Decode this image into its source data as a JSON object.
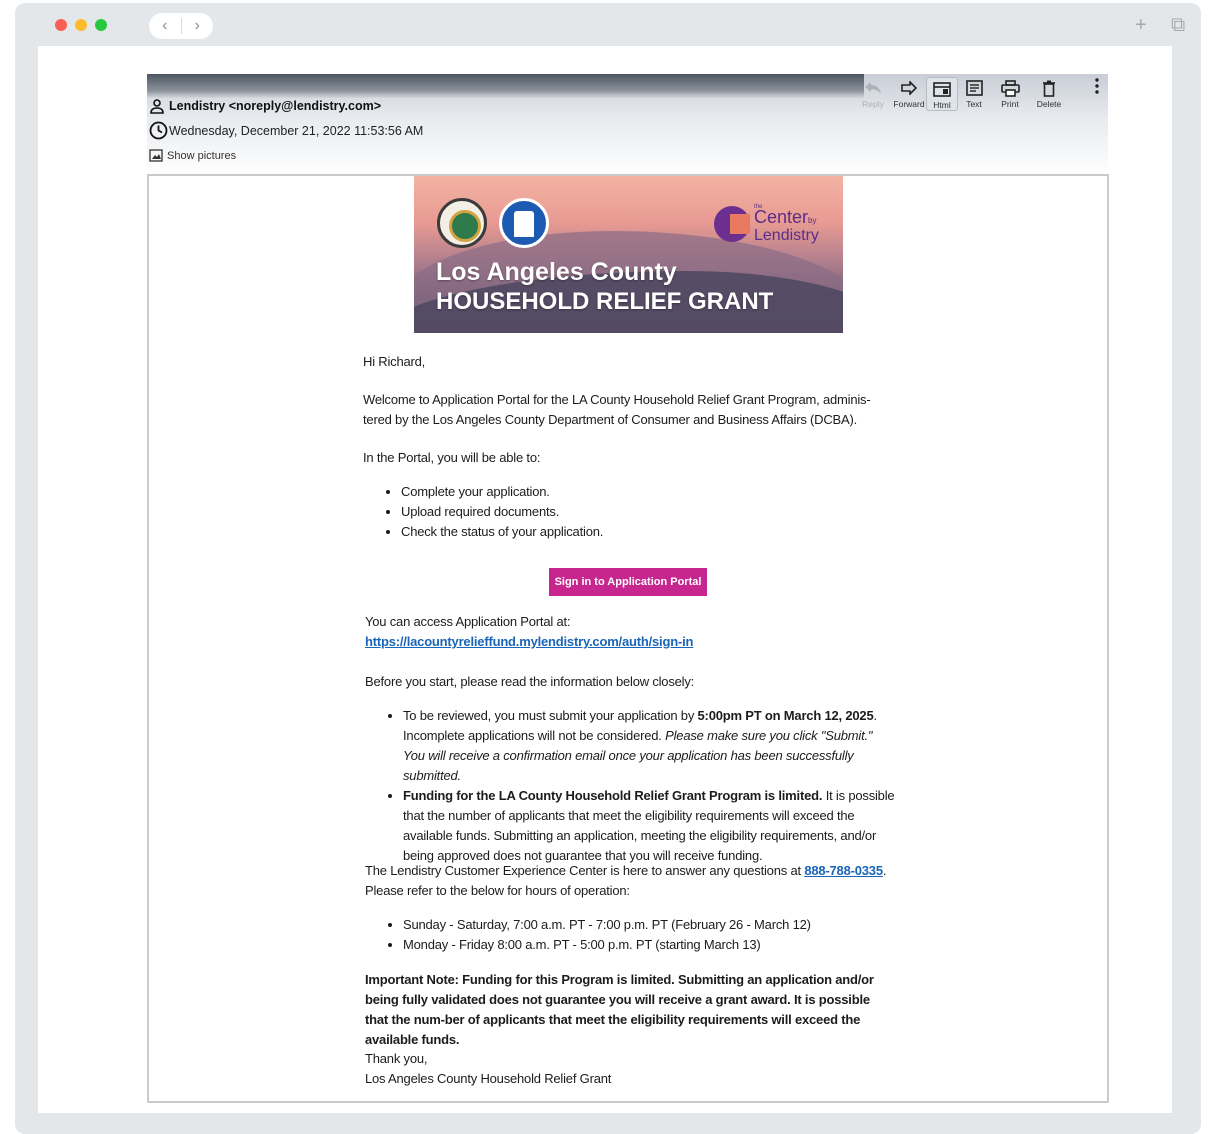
{
  "browser": {
    "nav_back": "‹",
    "nav_forward": "›",
    "new_tab": "+",
    "tabs_glyph": "⧉"
  },
  "email": {
    "from": "Lendistry <noreply@lendistry.com>",
    "date": "Wednesday, December 21, 2022 11:53:56 AM",
    "show_pictures": "Show pictures",
    "toolbar": {
      "reply": "Reply",
      "forward": "Forward",
      "html": "Html",
      "text": "Text",
      "print": "Print",
      "delete": "Delete"
    }
  },
  "hero": {
    "title_line1": "Los Angeles County",
    "title_line2": "HOUSEHOLD RELIEF GRANT",
    "brand_small": "the",
    "brand_center": "Center",
    "brand_by": "by",
    "brand_lendistry": "Lendistry"
  },
  "message": {
    "greeting": "Hi Richard,",
    "welcome": "Welcome to Application Portal for the LA County Household Relief Grant Program, adminis-tered by the Los Angeles County Department of Consumer and Business Affairs (DCBA).",
    "portal_intro": "In the Portal, you will be able to:",
    "portal_items": [
      "Complete your application.",
      "Upload required documents.",
      "Check the status of your application."
    ],
    "cta_label": "Sign in to Application Portal",
    "access_text": "You can access Application Portal at:",
    "access_url": "https://lacountyrelieffund.mylendistry.com/auth/sign-in",
    "before_start": "Before you start, please read the information below closely:",
    "info1_a": "To be reviewed, you must submit your application by ",
    "info1_b": "5:00pm PT on March 12, 2025",
    "info1_c": ". Incomplete applications will not be considered. ",
    "info1_d": "Please make sure you click \"Submit.\" You will receive a confirmation email once your application has been successfully submitted.",
    "info2_a": "Funding for the LA County Household Relief Grant Program is limited.",
    "info2_b": " It is possible that the number of applicants that meet the eligibility requirements will exceed the available funds. Submitting an application, meeting the eligibility requirements, and/or being approved does not guarantee that you will receive funding.",
    "support_a": "The Lendistry Customer Experience Center is here to answer any questions at ",
    "support_phone": "888-788-0335",
    "support_b": ". Please refer to the below for hours of operation:",
    "hours": [
      "Sunday - Saturday, 7:00 a.m. PT - 7:00 p.m. PT (February 26 - March 12)",
      "Monday - Friday 8:00 a.m. PT - 5:00 p.m. PT (starting March 13)"
    ],
    "important": "Important Note: Funding for this Program is limited. Submitting an application and/or being fully validated does not guarantee you will receive a grant award. It is possible that the num-ber of applicants that meet the eligibility requirements will exceed the available funds.",
    "signoff": "Thank you,",
    "signature": "Los Angeles County Household Relief Grant"
  }
}
